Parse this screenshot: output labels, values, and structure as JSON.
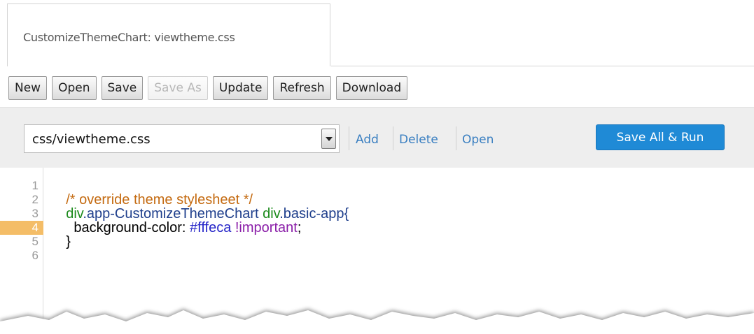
{
  "tab": {
    "title": "CustomizeThemeChart: viewtheme.css"
  },
  "toolbar": {
    "buttons": [
      {
        "label": "New",
        "enabled": true
      },
      {
        "label": "Open",
        "enabled": true
      },
      {
        "label": "Save",
        "enabled": true
      },
      {
        "label": "Save As",
        "enabled": false
      },
      {
        "label": "Update",
        "enabled": true
      },
      {
        "label": "Refresh",
        "enabled": true
      },
      {
        "label": "Download",
        "enabled": true
      }
    ]
  },
  "filebar": {
    "selected_file": "css/viewtheme.css",
    "links": {
      "add": "Add",
      "delete": "Delete",
      "open": "Open"
    },
    "save_all_run": "Save All & Run"
  },
  "editor": {
    "active_line": 4,
    "line_numbers": [
      "1",
      "2",
      "3",
      "4",
      "5",
      "6"
    ],
    "lines": [
      [
        {
          "t": "/* override theme stylesheet */",
          "c": "comment"
        }
      ],
      [
        {
          "t": "div",
          "c": "tag"
        },
        {
          "t": ".app-CustomizeThemeChart ",
          "c": "class"
        },
        {
          "t": "div",
          "c": "tag"
        },
        {
          "t": ".basic-app{",
          "c": "class"
        }
      ],
      [
        {
          "t": "  background-color: ",
          "c": "prop"
        },
        {
          "t": "#fffeca ",
          "c": "hex"
        },
        {
          "t": "!important",
          "c": "imp"
        },
        {
          "t": ";",
          "c": "prop"
        }
      ],
      [
        {
          "t": "}",
          "c": "prop"
        }
      ],
      [],
      []
    ]
  },
  "colors": {
    "primary_button": "#1f8ad6",
    "active_line": "#f4bd67",
    "link": "#3a7fc1"
  }
}
